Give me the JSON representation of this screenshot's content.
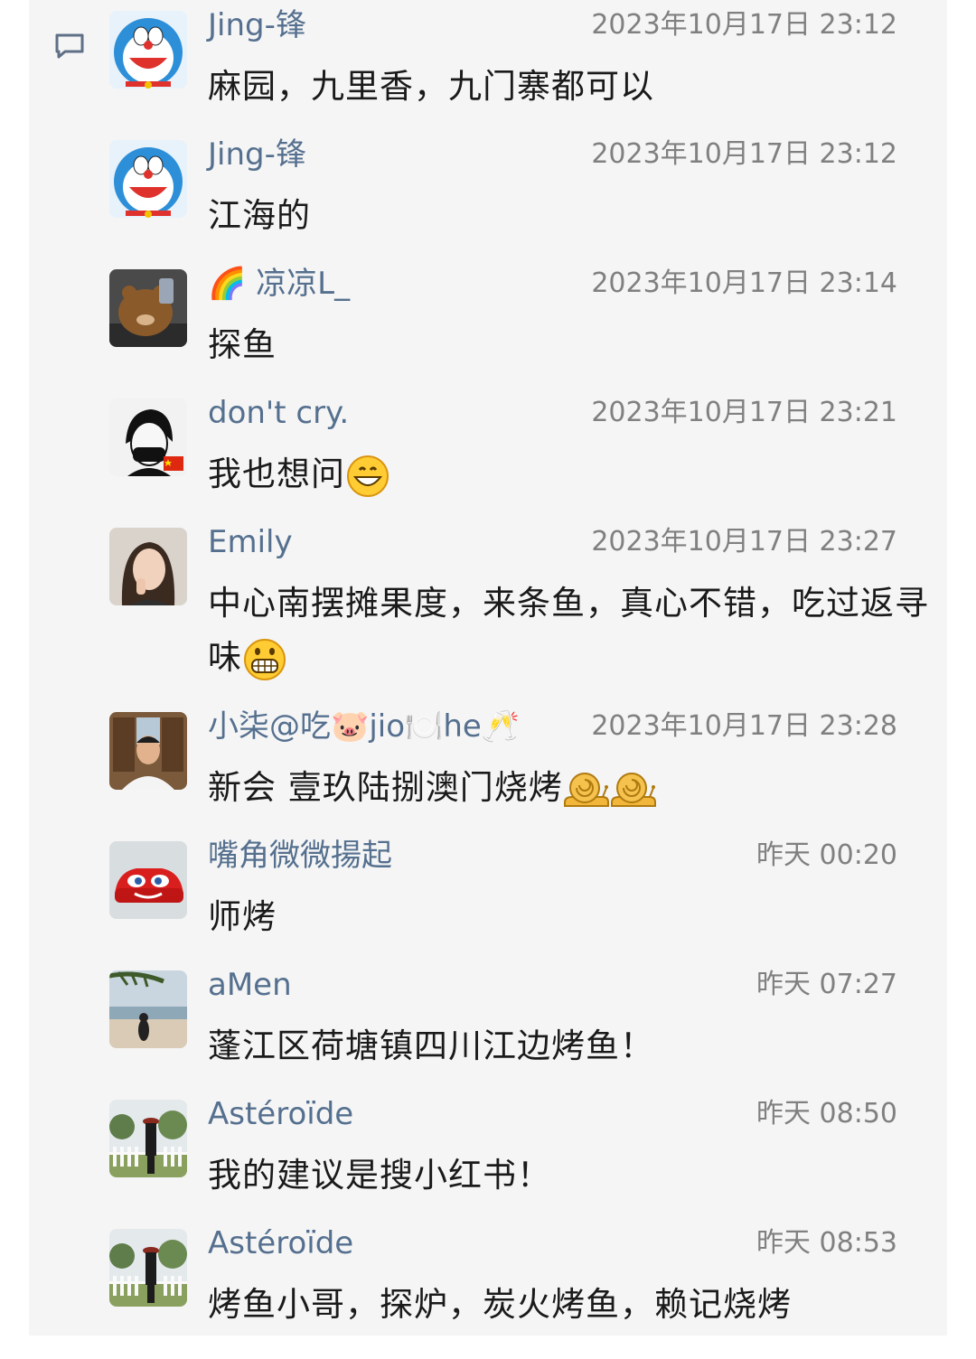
{
  "messages": [
    {
      "name": "Jing-锋",
      "time": "2023年10月17日 23:12",
      "text": "麻园，九里香，九门寨都可以",
      "avatar": "doraemon-avatar"
    },
    {
      "name": "Jing-锋",
      "time": "2023年10月17日 23:12",
      "text": "江海的",
      "avatar": "doraemon-avatar"
    },
    {
      "name_prefix": "🌈",
      "name": "凉凉L_",
      "time": "2023年10月17日 23:14",
      "text": "探鱼",
      "avatar": "bear-avatar"
    },
    {
      "name": "don't cry.",
      "time": "2023年10月17日 23:21",
      "text": "我也想问",
      "emoji": "grinning-emoji",
      "avatar": "masked-person-avatar"
    },
    {
      "name": "Emily",
      "time": "2023年10月17日 23:27",
      "text": "中心南摆摊果度，来条鱼，真心不错，吃过返寻味",
      "emoji": "grimacing-emoji",
      "avatar": "woman-avatar"
    },
    {
      "name": "小柒@吃🐷jio🍽️he🥂",
      "time": "2023年10月17日 23:28",
      "text": "新会 壹玖陆捌澳门烧烤",
      "emoji": "snail-emoji x2",
      "avatar": "man-avatar"
    },
    {
      "name": "嘴角微微揚起",
      "time": "昨天 00:20",
      "text": "师烤",
      "avatar": "red-car-avatar"
    },
    {
      "name": "aMen",
      "time": "昨天 07:27",
      "text": "蓬江区荷塘镇四川江边烤鱼！",
      "avatar": "beach-avatar"
    },
    {
      "name": "Astéroïde",
      "time": "昨天 08:50",
      "text": "我的建议是搜小红书！",
      "avatar": "garden-avatar"
    },
    {
      "name": "Astéroïde",
      "time": "昨天 08:53",
      "text": "烤鱼小哥，探炉，炭火烤鱼，赖记烧烤",
      "avatar": "garden-avatar"
    }
  ],
  "colors": {
    "name": "#55708f",
    "time": "#808080",
    "text": "#1a1a1a",
    "panel": "#f5f5f5"
  }
}
